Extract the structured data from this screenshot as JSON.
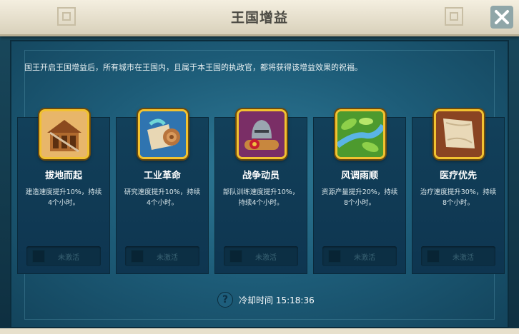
{
  "header": {
    "title": "王国增益"
  },
  "intro_text": "国王开启王国增益后，所有城市在王国内，且属于本王国的执政官，都将获得该增益效果的祝福。",
  "buffs": [
    {
      "name": "拔地而起",
      "desc1": "建造速度提升10%，持续",
      "desc2": "4个小时。",
      "status": "未激活",
      "icon": "building-icon"
    },
    {
      "name": "工业革命",
      "desc1": "研究速度提升10%，持续",
      "desc2": "4个小时。",
      "status": "未激活",
      "icon": "scroll-icon"
    },
    {
      "name": "战争动员",
      "desc1": "部队训练速度提升10%，",
      "desc2": "持续4个小时。",
      "status": "未激活",
      "icon": "helmet-icon"
    },
    {
      "name": "风调雨顺",
      "desc1": "资源产量提升20%，持续",
      "desc2": "8个小时。",
      "status": "未激活",
      "icon": "leaf-icon"
    },
    {
      "name": "医疗优先",
      "desc1": "治疗速度提升30%，持续",
      "desc2": "8个小时。",
      "status": "未激活",
      "icon": "bandage-icon"
    }
  ],
  "cooldown": {
    "label": "冷却时间 15:18:36"
  }
}
